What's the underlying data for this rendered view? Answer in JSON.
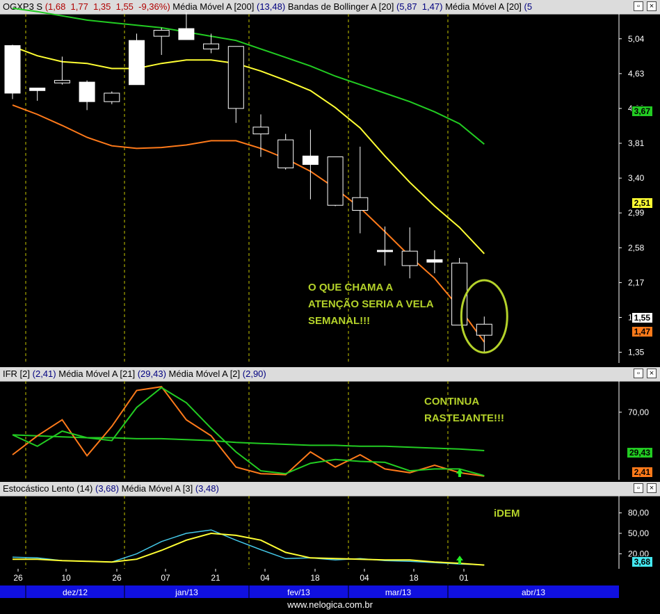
{
  "colors": {
    "ma200": "#22cc22",
    "boll": "#ffff33",
    "ma20": "#ff7a1a",
    "ifr": "#ff7a1a",
    "ifr_ma21": "#22cc22",
    "ifr_ma2": "#22cc22",
    "sto": "#44c8e8",
    "sto_ma3": "#ffff33",
    "grid_dash": "#c8c800",
    "annot": "#b4d22a"
  },
  "price_header": {
    "ticker": "OGXP3 S",
    "ohlc": "(1,68  1,77  1,35  1,55  -9,36%)",
    "ma200_label": "Média Móvel A [200]",
    "ma200_vals": "(13,48)",
    "boll_label": "Bandas de Bollinger A [20]",
    "boll_vals": "(5,87  1,47)",
    "ma20_label": "Média Móvel A [20]",
    "ma20_vals": "(5"
  },
  "ifr_header": {
    "label": "IFR [2]",
    "val": "(2,41)",
    "ma21_label": "Média Móvel A [21]",
    "ma21_val": "(29,43)",
    "ma2_label": "Média Móvel A [2]",
    "ma2_val": "(2,90)"
  },
  "sto_header": {
    "label": "Estocástico Lento (14)",
    "val": "(3,68)",
    "ma_label": "Média Móvel A [3]",
    "ma_val": "(3,48)"
  },
  "badges": {
    "ma200": "3,67",
    "boll": "2,51",
    "last": "1,55",
    "ma20": "1,47",
    "ifr_ma21": "29,43",
    "ifr": "2,41",
    "sto": "3,68"
  },
  "annotations": {
    "main": [
      "O QUE CHAMA A",
      "ATENÇÃO SERIA A VELA",
      "SEMANAL!!!"
    ],
    "ifr": [
      "CONTINUA",
      "RASTEJANTE!!!"
    ],
    "sto": [
      "iDEM"
    ]
  },
  "footer": "www.nelogica.com.br",
  "chart_data": [
    {
      "type": "candlestick",
      "price_ticks": [
        "5,04",
        "4,63",
        "4,22",
        "3,81",
        "3,40",
        "2,99",
        "2,58",
        "2,17",
        "1,76",
        "1,35"
      ],
      "ylim": [
        1.24,
        5.3
      ],
      "candles": [
        {
          "o": 4.4,
          "h": 4.97,
          "l": 4.33,
          "c": 4.96
        },
        {
          "o": 4.43,
          "h": 4.46,
          "l": 4.31,
          "c": 4.46
        },
        {
          "o": 4.55,
          "h": 4.83,
          "l": 4.5,
          "c": 4.52
        },
        {
          "o": 4.3,
          "h": 4.55,
          "l": 4.2,
          "c": 4.53
        },
        {
          "o": 4.4,
          "h": 4.42,
          "l": 4.27,
          "c": 4.3
        },
        {
          "o": 4.5,
          "h": 5.1,
          "l": 4.5,
          "c": 5.02
        },
        {
          "o": 5.14,
          "h": 5.17,
          "l": 4.85,
          "c": 5.07
        },
        {
          "o": 5.03,
          "h": 5.35,
          "l": 5.03,
          "c": 5.16
        },
        {
          "o": 4.98,
          "h": 5.1,
          "l": 4.87,
          "c": 4.92
        },
        {
          "o": 4.95,
          "h": 4.95,
          "l": 4.05,
          "c": 4.22
        },
        {
          "o": 4.0,
          "h": 4.15,
          "l": 3.65,
          "c": 3.92
        },
        {
          "o": 3.85,
          "h": 3.92,
          "l": 3.5,
          "c": 3.52
        },
        {
          "o": 3.56,
          "h": 3.97,
          "l": 3.15,
          "c": 3.66
        },
        {
          "o": 3.65,
          "h": 3.65,
          "l": 3.07,
          "c": 3.08
        },
        {
          "o": 3.17,
          "h": 3.77,
          "l": 2.75,
          "c": 3.02
        },
        {
          "o": 2.55,
          "h": 2.83,
          "l": 2.37,
          "c": 2.55
        },
        {
          "o": 2.54,
          "h": 2.82,
          "l": 2.22,
          "c": 2.37
        },
        {
          "o": 2.41,
          "h": 2.55,
          "l": 2.28,
          "c": 2.44
        },
        {
          "o": 2.4,
          "h": 2.46,
          "l": 1.67,
          "c": 1.67
        },
        {
          "o": 1.68,
          "h": 1.77,
          "l": 1.35,
          "c": 1.55
        }
      ],
      "ma200": [
        5.4,
        5.36,
        5.31,
        5.26,
        5.23,
        5.2,
        5.17,
        5.12,
        5.07,
        5.02,
        4.92,
        4.82,
        4.72,
        4.6,
        4.5,
        4.4,
        4.3,
        4.18,
        4.04,
        3.8
      ],
      "bollinger": [
        4.95,
        4.84,
        4.77,
        4.75,
        4.69,
        4.69,
        4.75,
        4.79,
        4.79,
        4.75,
        4.66,
        4.55,
        4.43,
        4.23,
        3.99,
        3.66,
        3.35,
        3.07,
        2.82,
        2.51
      ],
      "ma20": [
        4.26,
        4.15,
        4.02,
        3.88,
        3.78,
        3.75,
        3.76,
        3.79,
        3.84,
        3.84,
        3.75,
        3.63,
        3.48,
        3.28,
        3.05,
        2.77,
        2.48,
        2.22,
        1.87,
        1.47
      ]
    },
    {
      "type": "line",
      "name": "IFR",
      "y_ticks": [
        "70,00"
      ],
      "ylim": [
        0,
        100
      ],
      "ifr": [
        25,
        45,
        62,
        24,
        55,
        93,
        97,
        62,
        45,
        12,
        5,
        4,
        28,
        12,
        25,
        10,
        6,
        14,
        6,
        2.41
      ],
      "ma21": [
        46,
        45,
        44,
        43,
        43,
        42,
        42,
        41,
        40,
        38,
        37,
        36,
        35,
        35,
        34,
        34,
        33,
        32,
        31,
        29.43
      ],
      "ma2": [
        46,
        34,
        50,
        43,
        40,
        75,
        96,
        80,
        53,
        28,
        8,
        5,
        16,
        20,
        18,
        17,
        8,
        10,
        10,
        2.9
      ]
    },
    {
      "type": "line",
      "name": "Estocástico Lento",
      "y_ticks": [
        "80,00",
        "50,00",
        "20,00"
      ],
      "ylim": [
        0,
        100
      ],
      "sto": [
        15,
        14,
        10,
        9,
        8,
        20,
        38,
        50,
        55,
        40,
        26,
        13,
        14,
        11,
        13,
        10,
        9,
        7,
        5,
        3.68
      ],
      "sto_ma3": [
        12,
        12,
        10,
        9,
        8,
        12,
        25,
        40,
        50,
        47,
        40,
        22,
        14,
        13,
        12,
        11,
        11,
        8,
        6,
        3.48
      ]
    }
  ],
  "x_ticks": [
    "26",
    "10",
    "26",
    "07",
    "21",
    "04",
    "18",
    "04",
    "18",
    "01"
  ],
  "months": [
    "dez/12",
    "jan/13",
    "fev/13",
    "mar/13",
    "abr/13"
  ]
}
